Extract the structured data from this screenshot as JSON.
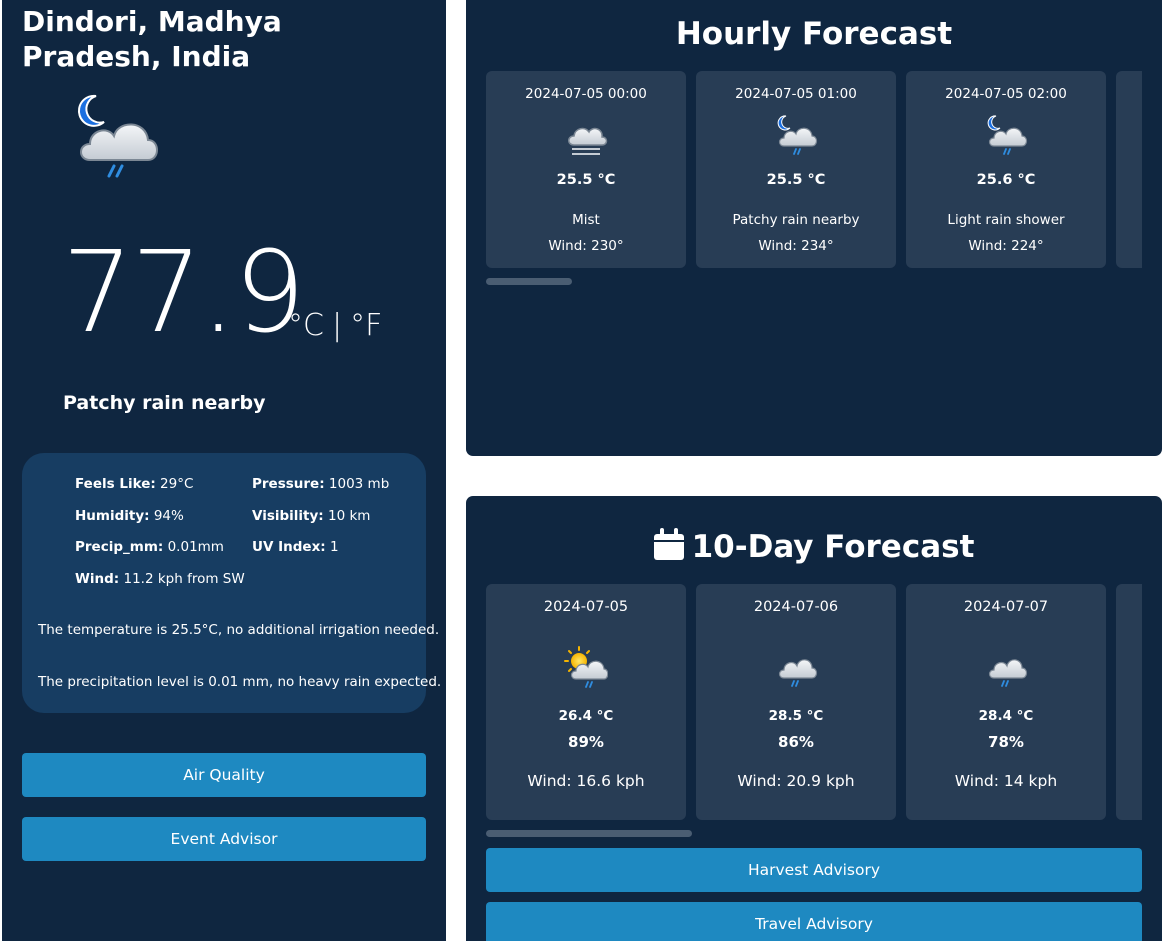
{
  "location": "Dindori, Madhya Pradesh, India",
  "current": {
    "icon": "moon-cloud-rain-icon",
    "temperature": "77.9",
    "unit_celsius": "°C",
    "unit_separator": "|",
    "unit_fahrenheit": "°F",
    "condition": "Patchy rain nearby"
  },
  "details": {
    "feels_like_label": "Feels Like:",
    "feels_like_value": "29°C",
    "pressure_label": "Pressure:",
    "pressure_value": "1003 mb",
    "humidity_label": "Humidity:",
    "humidity_value": "94%",
    "visibility_label": "Visibility:",
    "visibility_value": "10 km",
    "precip_label": "Precip_mm:",
    "precip_value": "0.01mm",
    "uv_label": "UV Index:",
    "uv_value": "1",
    "wind_label": "Wind:",
    "wind_value": "11.2 kph from SW",
    "note_temperature": "The temperature is 25.5°C, no additional irrigation needed.",
    "note_precipitation": "The precipitation level is 0.01 mm, no heavy rain expected."
  },
  "left_buttons": {
    "air_quality": "Air Quality",
    "event_advisor": "Event Advisor"
  },
  "hourly": {
    "title": "Hourly Forecast",
    "items": [
      {
        "time": "2024-07-05 00:00",
        "icon": "mist-cloud-icon",
        "temp": "25.5 °C",
        "condition": "Mist",
        "wind": "Wind: 230°"
      },
      {
        "time": "2024-07-05 01:00",
        "icon": "moon-cloud-rain-icon",
        "temp": "25.5 °C",
        "condition": "Patchy rain nearby",
        "wind": "Wind: 234°"
      },
      {
        "time": "2024-07-05 02:00",
        "icon": "moon-cloud-rain-icon",
        "temp": "25.6 °C",
        "condition": "Light rain shower",
        "wind": "Wind: 224°"
      }
    ]
  },
  "daily": {
    "title": "10-Day Forecast",
    "icon": "calendar-icon",
    "items": [
      {
        "date": "2024-07-05",
        "icon": "sun-cloud-rain-icon",
        "temp": "26.4 °C",
        "humidity": "89%",
        "wind": "Wind: 16.6 kph"
      },
      {
        "date": "2024-07-06",
        "icon": "cloud-rain-icon",
        "temp": "28.5 °C",
        "humidity": "86%",
        "wind": "Wind: 20.9 kph"
      },
      {
        "date": "2024-07-07",
        "icon": "cloud-rain-icon",
        "temp": "28.4 °C",
        "humidity": "78%",
        "wind": "Wind: 14 kph"
      }
    ]
  },
  "right_buttons": {
    "harvest_advisory": "Harvest Advisory",
    "travel_advisory": "Travel Advisory"
  },
  "colors": {
    "panel_bg": "#0f2640",
    "details_bg": "#173d62",
    "card_bg": "#283d55",
    "button_bg": "#1e89c1",
    "scrollbar": "#4a5d72"
  }
}
